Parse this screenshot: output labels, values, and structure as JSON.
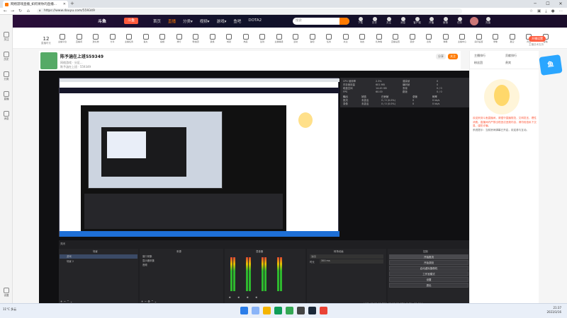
{
  "browser": {
    "tab_title": "网络游戏直播_如何将你的直播...",
    "url": "https://www.douyu.com/559349",
    "window_controls": [
      "─",
      "☐",
      "✕"
    ]
  },
  "sidebar": {
    "items": [
      {
        "label": "关注"
      },
      {
        "label": "历史"
      },
      {
        "label": "分类"
      },
      {
        "label": "直播"
      },
      {
        "label": "消息"
      },
      {
        "label": "设置"
      }
    ]
  },
  "site": {
    "brand": "斗鱼",
    "logo_badge": "斗鱼",
    "nav": [
      {
        "label": "首页",
        "active": false
      },
      {
        "label": "直播",
        "active": true
      },
      {
        "label": "分类▾",
        "active": false
      },
      {
        "label": "视频▾",
        "active": false
      },
      {
        "label": "游戏▾",
        "active": false
      },
      {
        "label": "鱼吧",
        "active": false
      },
      {
        "label": "DOTA2",
        "active": false
      }
    ],
    "search_placeholder": "搜索",
    "user_icons": [
      "下载",
      "历史",
      "关注",
      "消息",
      "客户端",
      "开播",
      "鱼粮",
      "任务",
      "创作",
      "充值"
    ]
  },
  "room_tools": {
    "count": "12",
    "count_label": "直播时长",
    "icons": [
      "主播平台",
      "直播间",
      "送礼物",
      "分享",
      "主播任务",
      "鱼丸",
      "鱼翅",
      "排行",
      "粉丝团",
      "贵族",
      "成就",
      "热度",
      "签到",
      "主播等级",
      "活动",
      "鱼吧",
      "任务",
      "关注",
      "动态",
      "礼物墙",
      "直播设置",
      "装扮",
      "表情",
      "弹幕",
      "主播中心",
      "房间设置",
      "录像",
      "星空",
      "背包",
      "宝箱",
      "抽奖",
      "更多",
      "充值",
      "设置"
    ],
    "right_button": "开播设置",
    "right_sub": "主播技术支持"
  },
  "streamer": {
    "title": "陈予涵在上班559349",
    "meta1": "网络游戏 · 分区...",
    "meta2": "陈予涵在上班 · 559349",
    "follow": "关注",
    "share": "分享"
  },
  "obs": {
    "stats": {
      "rows": [
        [
          "CPU 使用率",
          "2.3%",
          "渲染帧",
          "0"
        ],
        [
          "内存使用量",
          "601 MB",
          "编码帧",
          "0"
        ],
        [
          "磁盘空间",
          "14.45 GB",
          "丢帧",
          "0 / 0"
        ],
        [
          "FPS",
          "60.00",
          "跳帧",
          "0 / 0"
        ]
      ],
      "header": [
        "输出",
        "状态",
        "已丢帧",
        "总帧",
        "码率"
      ],
      "outputs": [
        [
          "推流",
          "未激活",
          "0 / 0 (0.0%)",
          "0",
          "0 kb/s"
        ],
        [
          "录像",
          "未激活",
          "0 / 0 (0.0%)",
          "0",
          "0 kb/s"
        ]
      ]
    },
    "scenes_title": "场景",
    "scenes": [
      "游戏",
      "场景 2"
    ],
    "sources_title": "来源",
    "sources": [
      "窗口采集",
      "显示器采集",
      "音频"
    ],
    "mixer_title": "混音器",
    "transitions_title": "转场动画",
    "transition_value": "淡出",
    "duration_label": "时长",
    "duration_value": "300 ms",
    "controls_title": "控制",
    "buttons": [
      "开始推流",
      "开始录制",
      "启动虚拟摄像机",
      "工作室模式",
      "设置",
      "退出"
    ],
    "status_bar": "LIVE: 00:00:00   REC: 00:00:00   CPU: 2.3%, 60.00 fps",
    "footer_label": "关闭"
  },
  "chat": {
    "tabs": [
      "主播排行",
      "贡献排行",
      "粉丝团",
      "贵宾"
    ],
    "welcome": "欢迎来到斗鱼直播间，请遵守直播规范，文明发言，理性消费。直播间内严禁出现违法违规内容，请勿轻信私下交易，谨防诈骗。",
    "notice": "系统提示：当前房间弹幕已开启，欢迎参与互动。"
  },
  "taskbar": {
    "weather": "11°C 多云",
    "time": "21:37",
    "date": "2023/3/16"
  }
}
